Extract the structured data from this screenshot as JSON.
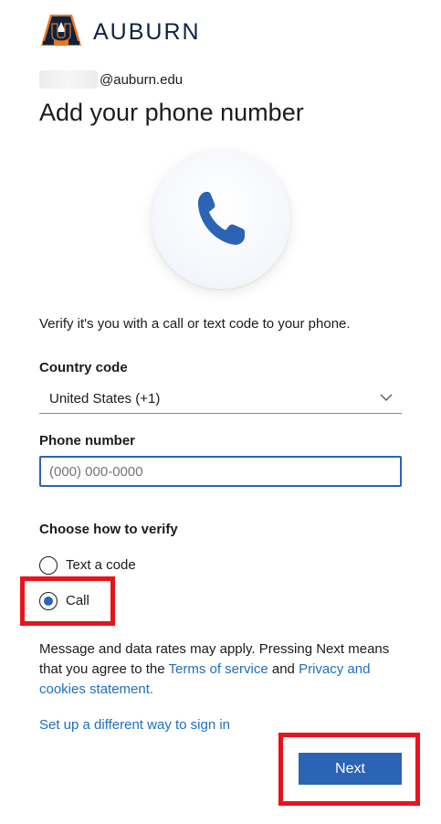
{
  "header": {
    "brand_name": "AUBURN",
    "logo_icon": "auburn-au-logo",
    "logo_colors": {
      "navy": "#0c2340",
      "orange": "#e87722"
    }
  },
  "identity": {
    "email_suffix": "@auburn.edu"
  },
  "page": {
    "title": "Add your phone number",
    "illustration_icon": "phone-icon",
    "description": "Verify it's you with a call or text code to your phone."
  },
  "form": {
    "country_code": {
      "label": "Country code",
      "value": "United States (+1)"
    },
    "phone_number": {
      "label": "Phone number",
      "placeholder": "(000) 000-0000"
    },
    "verify": {
      "label": "Choose how to verify",
      "options": [
        {
          "label": "Text a code",
          "selected": false
        },
        {
          "label": "Call",
          "selected": true
        }
      ]
    }
  },
  "disclaimer": {
    "text_before": "Message and data rates may apply. Pressing Next means that you agree to the ",
    "terms_link": "Terms of service",
    "text_middle": " and ",
    "privacy_link": "Privacy and cookies statement."
  },
  "links": {
    "alternate_signin": "Set up a different way to sign in"
  },
  "actions": {
    "next_label": "Next"
  },
  "colors": {
    "accent": "#2b63b5",
    "link": "#1f6ebf",
    "highlight": "#e8141c",
    "text": "#1b1b1b"
  }
}
